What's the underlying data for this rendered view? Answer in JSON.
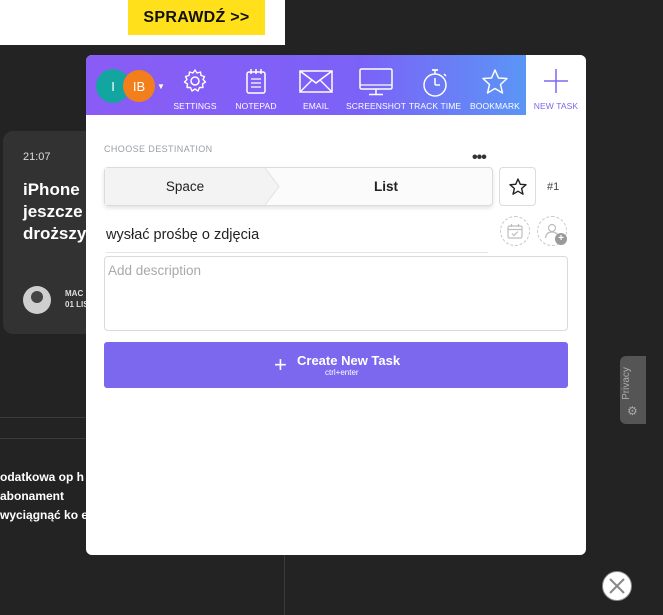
{
  "background": {
    "ad_button_label": "SPRAWDŹ >>",
    "card_time": "21:07",
    "card_headline": "iPhone jeszcze droższy",
    "card_author_line1": "MAC",
    "card_author_line2": "01 LIS",
    "article_text": "odatkowa op h abonament wyciągnąć ko e",
    "privacy_label": "Privacy"
  },
  "toolbar": {
    "users": [
      {
        "initials": "I",
        "color": "#13a5a0"
      },
      {
        "initials": "IB",
        "color": "#f27f1b"
      }
    ],
    "tools": [
      {
        "label": "SETTINGS",
        "icon": "gear-icon"
      },
      {
        "label": "NOTEPAD",
        "icon": "notepad-icon"
      },
      {
        "label": "EMAIL",
        "icon": "envelope-icon"
      },
      {
        "label": "SCREENSHOT",
        "icon": "monitor-icon"
      },
      {
        "label": "TRACK TIME",
        "icon": "stopwatch-icon"
      },
      {
        "label": "BOOKMARK",
        "icon": "star-icon"
      },
      {
        "label": "NEW TASK",
        "icon": "plus-icon",
        "active": true
      }
    ],
    "gradient": [
      "#8a5cf6",
      "#4fa8f5"
    ],
    "accent": "#7b68ee"
  },
  "form": {
    "destination_label": "CHOOSE DESTINATION",
    "breadcrumb_space": "Space",
    "breadcrumb_list": "List",
    "task_number": "#1",
    "task_name_value": "wysłać prośbę o zdjęcia",
    "description_placeholder": "Add description",
    "create_button_label": "Create New Task",
    "create_button_shortcut": "ctrl+enter"
  }
}
